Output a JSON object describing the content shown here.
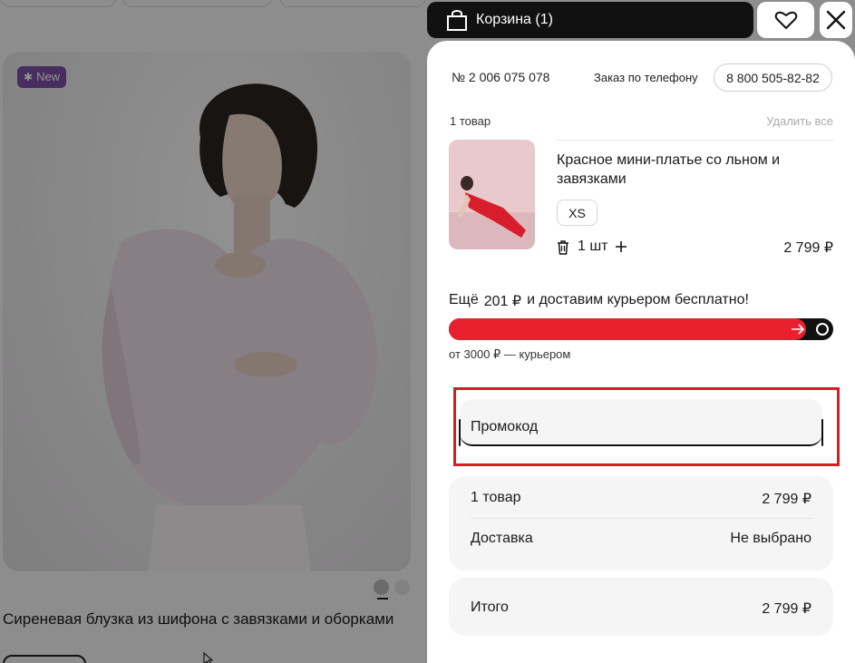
{
  "background": {
    "badge": "New",
    "product_title": "Сиреневая блузка из шифона с завязками и оборками"
  },
  "header": {
    "cart_label": "Корзина (1)"
  },
  "drawer": {
    "order_number": "№ 2 006 075 078",
    "phone_label": "Заказ по телефону",
    "phone_number": "8 800 505-82-82",
    "items_count": "1 товар",
    "delete_all": "Удалить все",
    "item": {
      "name": "Красное мини-платье со льном и завязками",
      "size": "XS",
      "quantity": "1 шт",
      "price": "2 799 ₽"
    },
    "free_delivery": {
      "prefix": "Ещё",
      "amount": "201 ₽",
      "suffix": "и доставим курьером бесплатно!",
      "progress_fraction": 0.93,
      "hint": "от 3000 ₽ — курьером"
    },
    "promo": {
      "placeholder": "Промокод"
    },
    "summary": {
      "items_label": "1 товар",
      "items_value": "2 799 ₽",
      "delivery_label": "Доставка",
      "delivery_value": "Не выбрано"
    },
    "total": {
      "label": "Итого",
      "value": "2 799 ₽"
    }
  },
  "colors": {
    "accent_red": "#e8202d",
    "highlight_red": "#d41e24",
    "badge_purple": "#7b4fa6"
  }
}
